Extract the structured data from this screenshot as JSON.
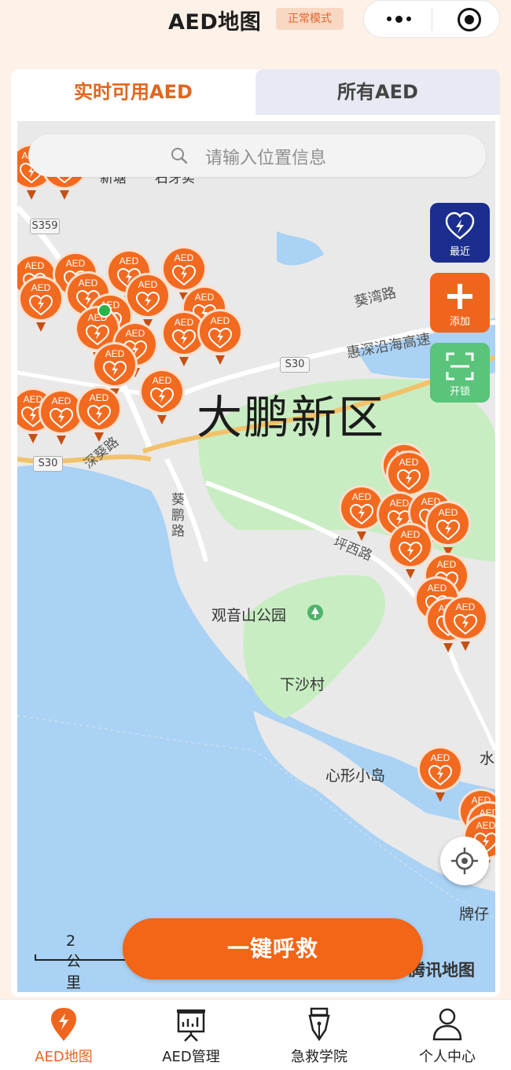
{
  "header": {
    "title": "AED地图",
    "mode_badge": "正常模式"
  },
  "tabs": [
    {
      "label": "实时可用AED",
      "active": true
    },
    {
      "label": "所有AED",
      "active": false
    }
  ],
  "search": {
    "placeholder": "请输入位置信息"
  },
  "side_buttons": {
    "recent": "最近",
    "add": "添加",
    "unlock": "开锁"
  },
  "map": {
    "district_label": "大鹏新区",
    "places": {
      "guanyinshan": "观音山公园",
      "xiasha": "下沙村",
      "xinxing": "心形小岛",
      "paizi": "牌仔",
      "shui": "水",
      "xinfa": "新塘",
      "shiya": "石牙实"
    },
    "roads": {
      "kuiwan": "葵湾路",
      "huishen": "惠深沿海高速",
      "kuipeng_v": "葵鹏路",
      "pingxi": "坪西路",
      "shenkui": "深葵路"
    },
    "shields": {
      "s359": "S359",
      "s30a": "S30",
      "s30b": "S30"
    },
    "marker_text": "AED",
    "scale_text": "2公里",
    "watermark": "腾讯地图"
  },
  "sos_button": "一键呼救",
  "colors": {
    "accent": "#f0651e",
    "recent_button": "#1b2e8f",
    "unlock_button": "#59c47a",
    "tab_inactive_bg": "#e7e9f3"
  },
  "bottom_nav": [
    {
      "label": "AED地图",
      "icon": "aed-map-pin-icon",
      "active": true
    },
    {
      "label": "AED管理",
      "icon": "presentation-board-icon",
      "active": false
    },
    {
      "label": "急救学院",
      "icon": "fountain-pen-icon",
      "active": false
    },
    {
      "label": "个人中心",
      "icon": "user-profile-icon",
      "active": false
    }
  ]
}
